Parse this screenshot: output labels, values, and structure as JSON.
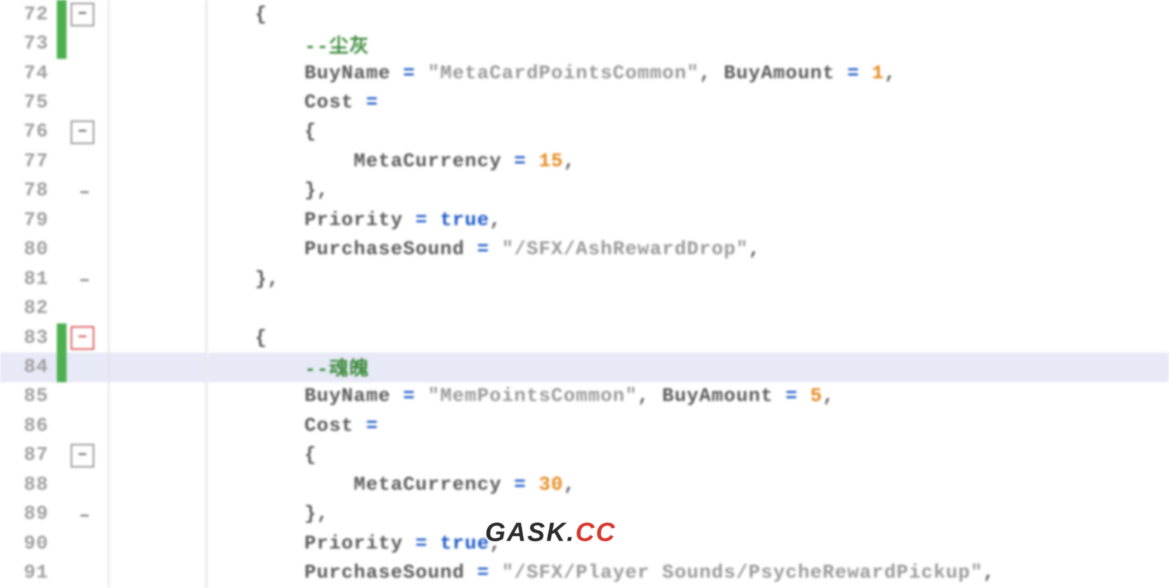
{
  "watermark": {
    "part1": "GASK.",
    "part2": "CC"
  },
  "lines": [
    {
      "num": "72",
      "change": "green",
      "fold": "box-gray",
      "vline": "gray",
      "indent": 0,
      "tokens": [
        {
          "t": "{",
          "c": ""
        }
      ]
    },
    {
      "num": "73",
      "change": "green",
      "fold": "",
      "vline": "gray",
      "indent": 1,
      "tokens": [
        {
          "t": "--尘灰",
          "c": "cmt"
        }
      ]
    },
    {
      "num": "74",
      "change": "",
      "fold": "",
      "vline": "gray",
      "indent": 1,
      "tokens": [
        {
          "t": "BuyName ",
          "c": ""
        },
        {
          "t": "=",
          "c": "kw"
        },
        {
          "t": " ",
          "c": ""
        },
        {
          "t": "\"MetaCardPointsCommon\"",
          "c": "str"
        },
        {
          "t": ", BuyAmount ",
          "c": ""
        },
        {
          "t": "=",
          "c": "kw"
        },
        {
          "t": " ",
          "c": ""
        },
        {
          "t": "1",
          "c": "num"
        },
        {
          "t": ",",
          "c": ""
        }
      ]
    },
    {
      "num": "75",
      "change": "",
      "fold": "",
      "vline": "gray",
      "indent": 1,
      "tokens": [
        {
          "t": "Cost ",
          "c": ""
        },
        {
          "t": "=",
          "c": "kw"
        }
      ]
    },
    {
      "num": "76",
      "change": "",
      "fold": "box-gray",
      "vline": "gray",
      "indent": 1,
      "tokens": [
        {
          "t": "{",
          "c": ""
        }
      ]
    },
    {
      "num": "77",
      "change": "",
      "fold": "",
      "vline": "gray",
      "indent": 2,
      "tokens": [
        {
          "t": "MetaCurrency ",
          "c": ""
        },
        {
          "t": "=",
          "c": "kw"
        },
        {
          "t": " ",
          "c": ""
        },
        {
          "t": "15",
          "c": "num"
        },
        {
          "t": ",",
          "c": ""
        }
      ]
    },
    {
      "num": "78",
      "change": "",
      "fold": "handle",
      "vline": "gray",
      "indent": 1,
      "tokens": [
        {
          "t": "},",
          "c": ""
        }
      ]
    },
    {
      "num": "79",
      "change": "",
      "fold": "",
      "vline": "gray",
      "indent": 1,
      "tokens": [
        {
          "t": "Priority ",
          "c": ""
        },
        {
          "t": "=",
          "c": "kw"
        },
        {
          "t": " ",
          "c": ""
        },
        {
          "t": "true",
          "c": "kw"
        },
        {
          "t": ",",
          "c": ""
        }
      ]
    },
    {
      "num": "80",
      "change": "",
      "fold": "",
      "vline": "gray",
      "indent": 1,
      "tokens": [
        {
          "t": "PurchaseSound ",
          "c": ""
        },
        {
          "t": "=",
          "c": "kw"
        },
        {
          "t": " ",
          "c": ""
        },
        {
          "t": "\"/SFX/AshRewardDrop\"",
          "c": "str"
        },
        {
          "t": ",",
          "c": ""
        }
      ]
    },
    {
      "num": "81",
      "change": "",
      "fold": "handle",
      "vline": "gray",
      "indent": 0,
      "tokens": [
        {
          "t": "},",
          "c": ""
        }
      ]
    },
    {
      "num": "82",
      "change": "",
      "fold": "",
      "vline": "gray",
      "indent": 0,
      "tokens": []
    },
    {
      "num": "83",
      "change": "green",
      "fold": "box-red",
      "vline": "red",
      "indent": 0,
      "tokens": [
        {
          "t": "{",
          "c": ""
        }
      ]
    },
    {
      "num": "84",
      "change": "green",
      "fold": "",
      "vline": "red",
      "indent": 1,
      "cursor": true,
      "tokens": [
        {
          "t": "--魂魄",
          "c": "cmt"
        }
      ]
    },
    {
      "num": "85",
      "change": "",
      "fold": "",
      "vline": "red",
      "indent": 1,
      "tokens": [
        {
          "t": "BuyName ",
          "c": ""
        },
        {
          "t": "=",
          "c": "kw"
        },
        {
          "t": " ",
          "c": ""
        },
        {
          "t": "\"MemPointsCommon\"",
          "c": "str"
        },
        {
          "t": ", BuyAmount ",
          "c": ""
        },
        {
          "t": "=",
          "c": "kw"
        },
        {
          "t": " ",
          "c": ""
        },
        {
          "t": "5",
          "c": "num"
        },
        {
          "t": ",",
          "c": ""
        }
      ]
    },
    {
      "num": "86",
      "change": "",
      "fold": "",
      "vline": "red",
      "indent": 1,
      "tokens": [
        {
          "t": "Cost ",
          "c": ""
        },
        {
          "t": "=",
          "c": "kw"
        }
      ]
    },
    {
      "num": "87",
      "change": "",
      "fold": "box-gray",
      "vline": "red",
      "indent": 1,
      "tokens": [
        {
          "t": "{",
          "c": ""
        }
      ]
    },
    {
      "num": "88",
      "change": "",
      "fold": "",
      "vline": "red",
      "indent": 2,
      "tokens": [
        {
          "t": "MetaCurrency ",
          "c": ""
        },
        {
          "t": "=",
          "c": "kw"
        },
        {
          "t": " ",
          "c": ""
        },
        {
          "t": "30",
          "c": "num"
        },
        {
          "t": ",",
          "c": ""
        }
      ]
    },
    {
      "num": "89",
      "change": "",
      "fold": "handle",
      "vline": "red",
      "indent": 1,
      "tokens": [
        {
          "t": "},",
          "c": ""
        }
      ]
    },
    {
      "num": "90",
      "change": "",
      "fold": "",
      "vline": "red",
      "indent": 1,
      "tokens": [
        {
          "t": "Priority ",
          "c": ""
        },
        {
          "t": "=",
          "c": "kw"
        },
        {
          "t": " ",
          "c": ""
        },
        {
          "t": "true",
          "c": "kw"
        },
        {
          "t": ",",
          "c": ""
        }
      ]
    },
    {
      "num": "91",
      "change": "",
      "fold": "",
      "vline": "red",
      "indent": 1,
      "tokens": [
        {
          "t": "PurchaseSound ",
          "c": ""
        },
        {
          "t": "=",
          "c": "kw"
        },
        {
          "t": " ",
          "c": ""
        },
        {
          "t": "\"/SFX/Player Sounds/PsycheRewardPickup\"",
          "c": "str"
        },
        {
          "t": ",",
          "c": ""
        }
      ]
    }
  ]
}
